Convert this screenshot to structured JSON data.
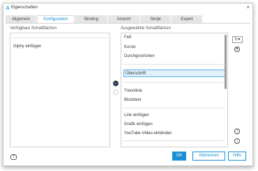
{
  "window": {
    "title": "Eigenschaften",
    "close_icon": "close-icon"
  },
  "tabs": [
    {
      "label": "Allgemein"
    },
    {
      "label": "Konfiguration"
    },
    {
      "label": "Binding"
    },
    {
      "label": "Ansicht"
    },
    {
      "label": "Skript"
    },
    {
      "label": "Expert"
    }
  ],
  "active_tab": "Konfiguration",
  "available": {
    "header": "Verfügbare Schaltflächen",
    "items": [
      "Giphy einfügen"
    ]
  },
  "selected": {
    "header": "Ausgewählte Schaltflächen",
    "items": [
      "Fett",
      "Kursiv",
      "Durchgestrichen",
      "Überschrift",
      "Trennlinie",
      "Blocktext",
      "Link einfügen",
      "Grafik einfügen",
      "YouTube-Video einbinden"
    ],
    "highlighted": "Überschrift"
  },
  "icons": {
    "reset": "reset-icon",
    "dropdown": "chevron-down-icon",
    "remove": "remove-icon",
    "move_left": "arrow-left-icon",
    "move_right": "arrow-right-icon",
    "move_up": "arrow-up-icon",
    "move_down": "arrow-down-icon",
    "help": "help-icon"
  },
  "buttons": {
    "ok": "OK",
    "cancel": "Abbrechen",
    "help": "Hilfe"
  },
  "colors": {
    "accent": "#1a8fd4",
    "selection_bg": "#dff0fb",
    "selection_border": "#5fb4e6"
  }
}
